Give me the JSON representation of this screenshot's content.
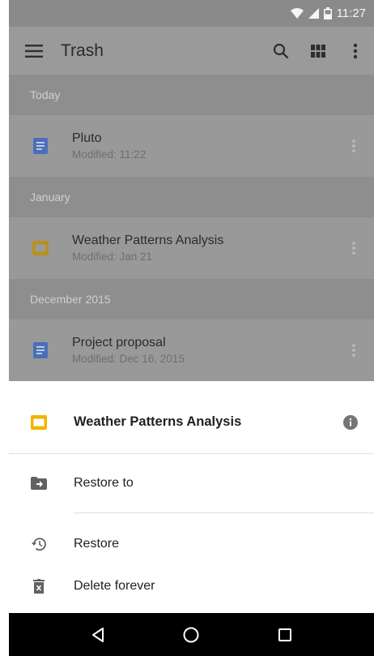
{
  "status_bar": {
    "time": "11:27"
  },
  "toolbar": {
    "title": "Trash"
  },
  "sections": [
    {
      "header": "Today",
      "file": {
        "name": "Pluto",
        "modified": "Modified: 11:22",
        "type": "doc"
      }
    },
    {
      "header": "January",
      "file": {
        "name": "Weather Patterns Analysis",
        "modified": "Modified: Jan 21",
        "type": "slides"
      }
    },
    {
      "header": "December 2015",
      "file": {
        "name": "Project proposal",
        "modified": "Modified: Dec 16, 2015",
        "type": "doc"
      }
    }
  ],
  "sheet": {
    "title": "Weather Patterns Analysis",
    "actions": {
      "restore_to": "Restore to",
      "restore": "Restore",
      "delete_forever": "Delete forever"
    }
  },
  "colors": {
    "doc_blue": "#4a6fb8",
    "slides_yellow": "#f4b400",
    "dim_overlay": "#9a9a9a"
  },
  "icons": [
    "menu-icon",
    "search-icon",
    "grid-view-icon",
    "more-vert-icon",
    "info-icon",
    "folder-move-icon",
    "history-icon",
    "trash-icon",
    "back-icon",
    "home-icon",
    "recents-icon"
  ]
}
